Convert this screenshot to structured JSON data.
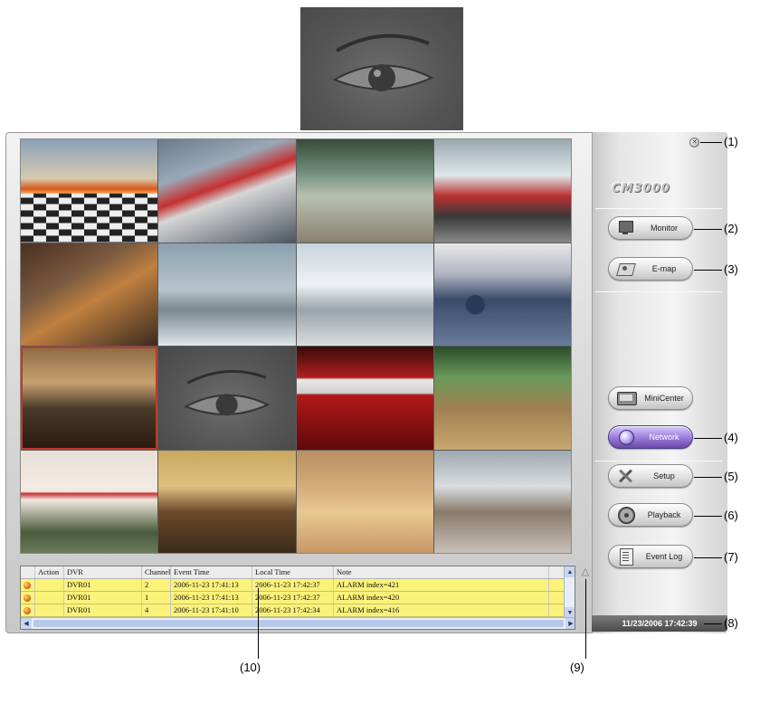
{
  "app": {
    "brand": "CM3000"
  },
  "cameras": [
    {
      "scene": "station1"
    },
    {
      "scene": "station2"
    },
    {
      "scene": "station3"
    },
    {
      "scene": "station4"
    },
    {
      "scene": "work1"
    },
    {
      "scene": "lobby"
    },
    {
      "scene": "airport"
    },
    {
      "scene": "crowd"
    },
    {
      "scene": "hall",
      "selected": true
    },
    {
      "scene": "eye"
    },
    {
      "scene": "theater"
    },
    {
      "scene": "garden"
    },
    {
      "scene": "class1"
    },
    {
      "scene": "class2"
    },
    {
      "scene": "gym"
    },
    {
      "scene": "class3"
    }
  ],
  "event_log": {
    "columns": [
      "",
      "Action",
      "DVR",
      "Channel",
      "Event Time",
      "Local Time",
      "Note"
    ],
    "rows": [
      {
        "dvr": "DVR01",
        "channel": "2",
        "event_time": "2006-11-23 17:41:13",
        "local_time": "2006-11-23 17:42:37",
        "note": "ALARM index=421"
      },
      {
        "dvr": "DVR01",
        "channel": "1",
        "event_time": "2006-11-23 17:41:13",
        "local_time": "2006-11-23 17:42:37",
        "note": "ALARM index=420"
      },
      {
        "dvr": "DVR01",
        "channel": "4",
        "event_time": "2006-11-23 17:41:10",
        "local_time": "2006-11-23 17:42:34",
        "note": "ALARM index=416"
      }
    ]
  },
  "panel": {
    "buttons": {
      "monitor": "Monitor",
      "emap": "E-map",
      "minicenter": "MiniCenter",
      "network": "Network",
      "setup": "Setup",
      "playback": "Playback",
      "eventlog": "Event Log"
    },
    "clock": "11/23/2006 17:42:39"
  },
  "callouts": {
    "c1": "(1)",
    "c2": "(2)",
    "c3": "(3)",
    "c4": "(4)",
    "c5": "(5)",
    "c6": "(6)",
    "c7": "(7)",
    "c8": "(8)",
    "c9": "(9)",
    "c10": "(10)"
  },
  "colors": {
    "event_row": "#fbf27a",
    "network_active": "#9a7ad8",
    "selected_camera": "#c0392b"
  },
  "icons": [
    "close-icon",
    "monitor-icon",
    "emap-icon",
    "minicenter-icon",
    "network-icon",
    "setup-icon",
    "playback-icon",
    "eventlog-icon",
    "alarm-led-icon",
    "collapse-arrow-icon"
  ]
}
